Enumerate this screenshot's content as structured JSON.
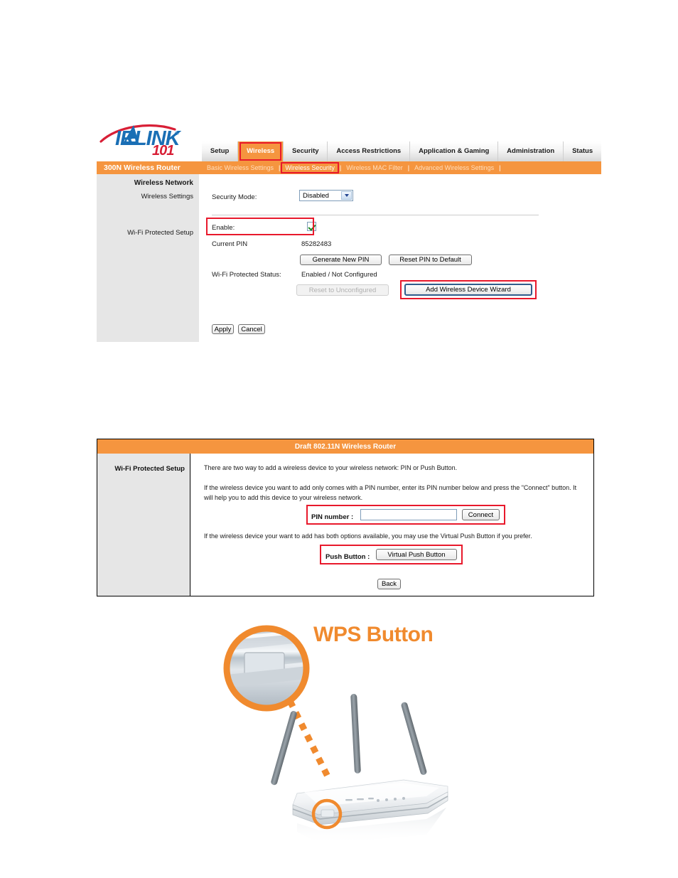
{
  "colors": {
    "brand_orange": "#f5953f",
    "highlight_red": "#e8192c",
    "logo_blue": "#1a6fb5",
    "logo_red": "#d81f36",
    "panel_gray": "#e6e6e6",
    "wps_orange": "#f08a2e"
  },
  "panel1": {
    "logo": {
      "air": "A",
      "irlink": "IRLINK",
      "registered": "®",
      "model": "101"
    },
    "tabs": [
      {
        "label": "Setup",
        "active": false,
        "highlighted": false
      },
      {
        "label": "Wireless",
        "active": true,
        "highlighted": true
      },
      {
        "label": "Security",
        "active": false,
        "highlighted": false
      },
      {
        "label": "Access Restrictions",
        "active": false,
        "highlighted": false
      },
      {
        "label": "Application & Gaming",
        "active": false,
        "highlighted": false
      },
      {
        "label": "Administration",
        "active": false,
        "highlighted": false
      },
      {
        "label": "Status",
        "active": false,
        "highlighted": false
      }
    ],
    "subnav": {
      "brand": "300N Wireless Router",
      "items": [
        {
          "label": "Basic Wireless Settings",
          "highlighted": false
        },
        {
          "label": "Wireless Security",
          "highlighted": true
        },
        {
          "label": "Wireless MAC Filter",
          "highlighted": false
        },
        {
          "label": "Advanced Wireless Settings",
          "highlighted": false
        }
      ],
      "separator": "|"
    },
    "sidebar": {
      "heading": "Wireless Network",
      "item_wireless_settings": "Wireless Settings",
      "item_wps": "Wi-Fi Protected Setup"
    },
    "form": {
      "security_mode_label": "Security Mode:",
      "security_mode_value": "Disabled",
      "security_mode_options": [
        "Disabled"
      ],
      "enable_label": "Enable:",
      "enable_checked": true,
      "current_pin_label": "Current PIN",
      "current_pin_value": "85282483",
      "generate_pin_button": "Generate New PIN",
      "reset_pin_button": "Reset PIN to Default",
      "wps_status_label": "Wi-Fi Protected Status:",
      "wps_status_value": "Enabled / Not Configured",
      "reset_unconfigured_button": "Reset to Unconfigured",
      "reset_unconfigured_disabled": true,
      "add_wizard_button": "Add Wireless Device Wizard",
      "apply_button": "Apply",
      "cancel_button": "Cancel"
    }
  },
  "panel2": {
    "title": "Draft 802.11N Wireless Router",
    "section_label": "Wi-Fi Protected Setup",
    "paragraph1": "There are two way to add a wireless device to your wireless network: PIN or Push Button.",
    "paragraph2": "If the wireless device you want to add only comes with a PIN number, enter its PIN number below and press the \"Connect\" button. It will help you to add this device to your wireless network.",
    "pin_label": "PIN number :",
    "pin_value": "",
    "pin_placeholder": "",
    "connect_button": "Connect",
    "paragraph3": "If the wireless device your want to add has both options available, you may use the Virtual Push Button if you prefer.",
    "push_button_label": "Push Button :",
    "virtual_push_button": "Virtual Push Button",
    "back_button": "Back"
  },
  "illustration": {
    "caption": "WPS Button",
    "alt": "Photo of a wireless router with a magnified callout circle highlighting the WPS button on the front edge, connected by an orange dotted line."
  }
}
